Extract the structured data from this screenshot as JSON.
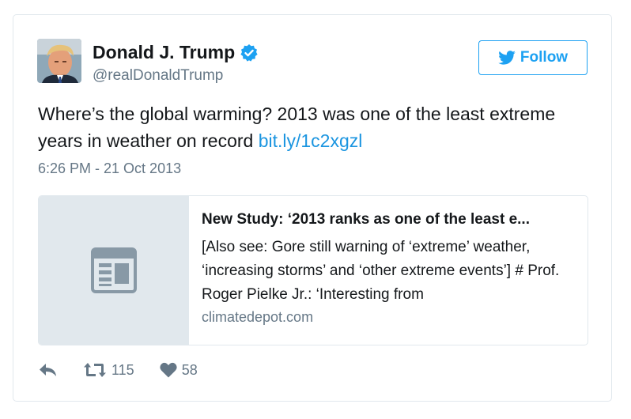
{
  "user": {
    "name": "Donald J. Trump",
    "handle": "@realDonaldTrump",
    "verified": true,
    "avatar_icon": "avatar-photo"
  },
  "follow_button": {
    "label": "Follow",
    "icon": "twitter-bird-icon"
  },
  "tweet": {
    "text": "Where’s the global warming? 2013 was one of the least extreme years in weather on record",
    "link": "bit.ly/1c2xgzl",
    "timestamp": "6:26 PM - 21 Oct 2013"
  },
  "card": {
    "title": "New Study: ‘2013 ranks as one of the least e...",
    "description": "[Also see: Gore still warning of ‘extreme’ weather, ‘increasing storms’ and ‘other extreme events’] # Prof. Roger Pielke Jr.: ‘Interesting from",
    "domain": "climatedepot.com",
    "thumb_icon": "article-icon"
  },
  "actions": {
    "reply_icon": "reply-icon",
    "retweet_icon": "retweet-icon",
    "retweet_count": "115",
    "like_icon": "heart-icon",
    "like_count": "58"
  },
  "colors": {
    "accent": "#1da1f2",
    "link": "#1b95e0",
    "secondary_text": "#657786",
    "border": "#e1e8ed"
  }
}
